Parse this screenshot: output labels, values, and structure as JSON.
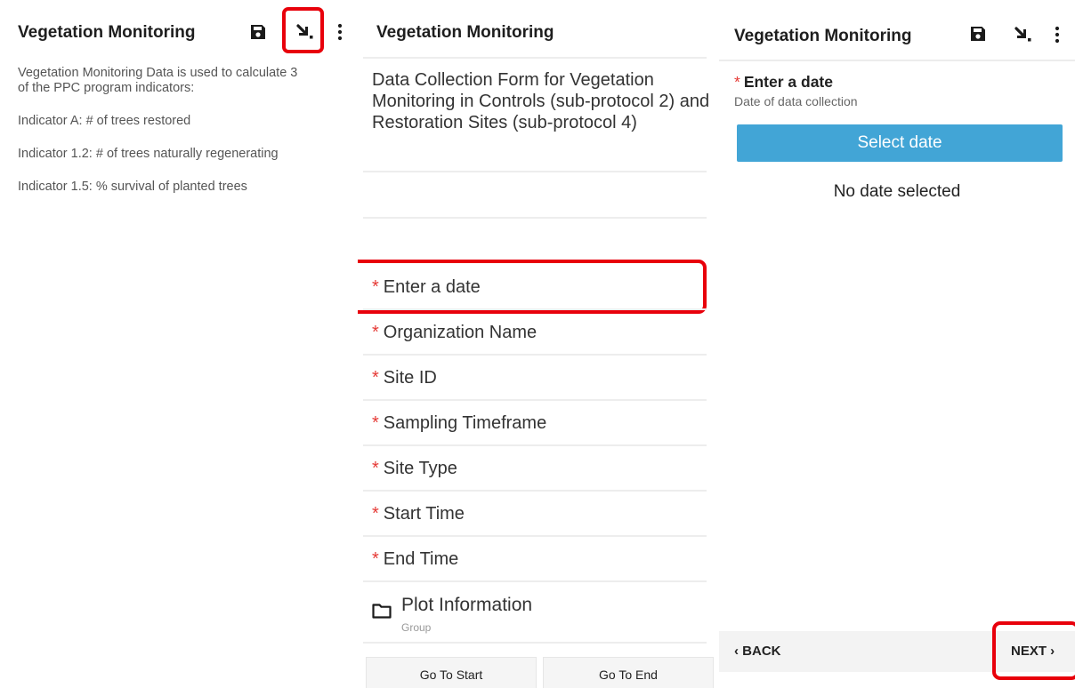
{
  "panel_summary": {
    "title": "Vegetation Monitoring",
    "description_lines": [
      "Vegetation Monitoring Data is used to calculate 3",
      "of the PPC program indicators:",
      "Indicator A: # of trees restored",
      "Indicator 1.2: # of trees naturally regenerating",
      "Indicator 1.5: % survival of planted trees"
    ],
    "icons": [
      "save-icon",
      "go-to-prompt-icon",
      "more-vert-icon"
    ],
    "highlight_color": "#e8000b"
  },
  "panel_hierarchy": {
    "title": "Vegetation Monitoring",
    "intro": "Data Collection Form for Vegetation Monitoring in Controls (sub-protocol 2) and Restoration Sites (sub-protocol 4)",
    "required_marker": "*",
    "required_color": "#e53935",
    "questions": [
      "Enter a date",
      "Organization Name",
      "Site ID",
      "Sampling Timeframe",
      "Site Type",
      "Start Time",
      "End Time"
    ],
    "group": {
      "title": "Plot Information",
      "subtitle": "Group"
    },
    "go_to_start": "Go To Start",
    "go_to_end": "Go To End"
  },
  "panel_question": {
    "title": "Vegetation Monitoring",
    "required_marker": "*",
    "question_label": "Enter a date",
    "question_hint": "Date of data collection",
    "select_button": "Select date",
    "select_button_color": "#42a5d6",
    "status": "No date selected",
    "back_label": "‹ BACK",
    "next_label": "NEXT ›"
  }
}
